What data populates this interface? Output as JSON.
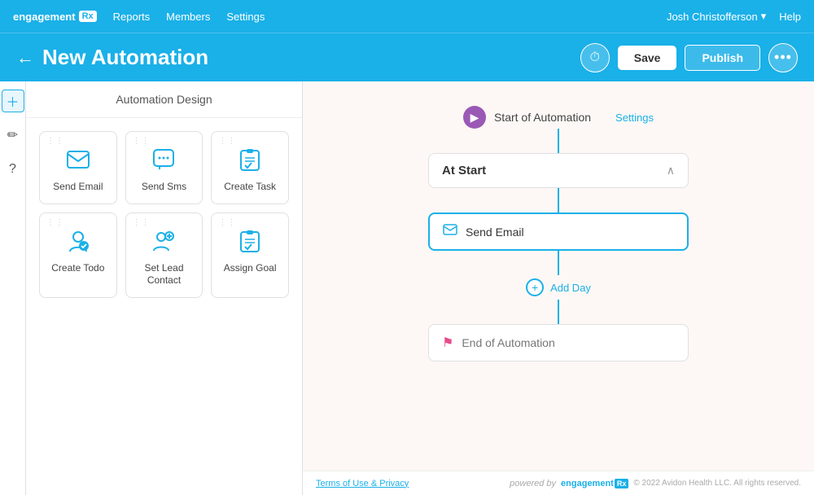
{
  "nav": {
    "logo_text": "engagement",
    "logo_rx": "Rx",
    "links": [
      "Reports",
      "Members",
      "Settings"
    ],
    "user": "Josh Christofferson",
    "help": "Help"
  },
  "header": {
    "back_label": "←",
    "title": "New Automation",
    "save_label": "Save",
    "publish_label": "Publish"
  },
  "design_panel": {
    "title": "Automation Design",
    "items": [
      {
        "id": "send-email",
        "label": "Send Email",
        "icon": "✉"
      },
      {
        "id": "send-sms",
        "label": "Send Sms",
        "icon": "💬"
      },
      {
        "id": "create-task",
        "label": "Create Task",
        "icon": "📋"
      },
      {
        "id": "create-todo",
        "label": "Create Todo",
        "icon": "👤"
      },
      {
        "id": "set-lead-contact",
        "label": "Set Lead\nContact",
        "icon": "👤"
      },
      {
        "id": "assign-goal",
        "label": "Assign Goal",
        "icon": "📋"
      }
    ]
  },
  "flow": {
    "start_label": "Start of Automation",
    "settings_label": "Settings",
    "at_start_label": "At Start",
    "send_email_label": "Send Email",
    "add_day_label": "Add Day",
    "end_label": "End of Automation"
  },
  "footer": {
    "terms": "Terms of Use & Privacy",
    "powered_by": "powered by",
    "brand": "engagement",
    "brand_rx": "Rx",
    "copyright": "© 2022 Avidon Health LLC. All rights reserved."
  }
}
